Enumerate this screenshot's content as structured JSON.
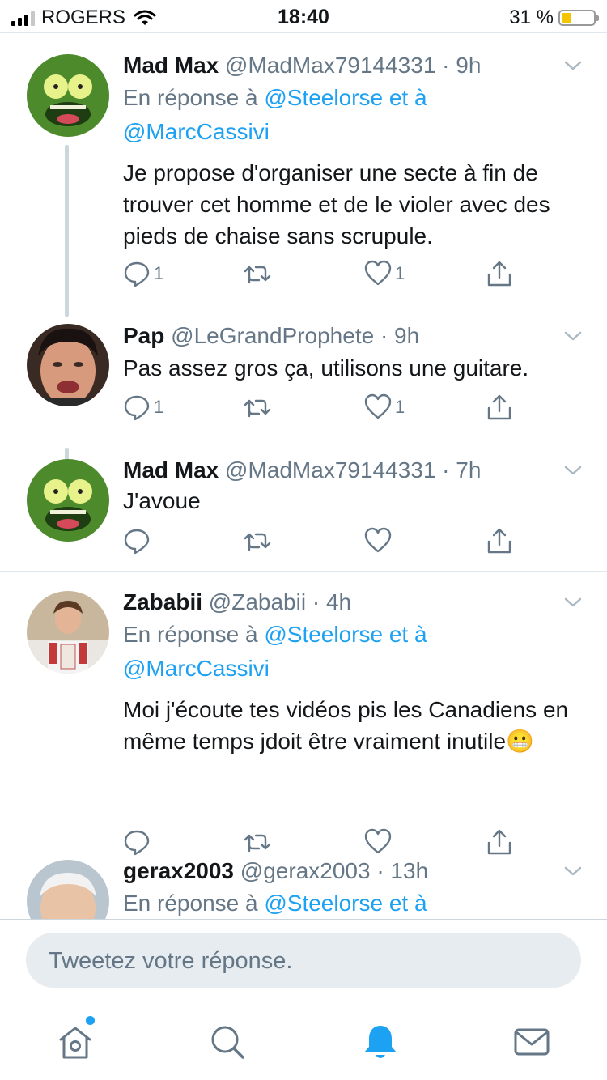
{
  "status": {
    "carrier": "ROGERS",
    "time": "18:40",
    "battery_pct": "31 %",
    "battery_level": 0.31
  },
  "tweets": [
    {
      "name": "Mad Max",
      "handle": "@MadMax79144331 · 9h",
      "reply_prefix": "En réponse à ",
      "reply_mention_1": "@Steelorse",
      "reply_mid": " et à",
      "reply_mention_2": "@MarcCassivi",
      "text": "Je propose d'organiser une secte à fin de trouver cet homme et de le violer avec des pieds de chaise sans scrupule.",
      "reply_count": "1",
      "like_count": "1"
    },
    {
      "name": "Pap",
      "handle": "@LeGrandProphete · 9h",
      "text": "Pas assez gros ça, utilisons une guitare.",
      "reply_count": "1",
      "like_count": "1"
    },
    {
      "name": "Mad Max",
      "handle": "@MadMax79144331 · 7h",
      "text": "J'avoue",
      "reply_count": "",
      "like_count": ""
    },
    {
      "name": "Zababii",
      "handle": "@Zababii · 4h",
      "reply_prefix": "En réponse à ",
      "reply_mention_1": "@Steelorse",
      "reply_mid": " et à",
      "reply_mention_2": "@MarcCassivi",
      "text": "Moi j'écoute tes vidéos pis les Canadiens en même temps jdoit être vraiment inutile",
      "emoji": "😬",
      "reply_count": "",
      "like_count": ""
    },
    {
      "name": "gerax2003",
      "handle": "@gerax2003 · 13h",
      "reply_prefix": "En réponse à ",
      "reply_mention_1": "@Steelorse",
      "reply_mid": " et à"
    }
  ],
  "composer": {
    "placeholder": "Tweetez votre réponse."
  },
  "tabs": [
    "home-icon",
    "search-icon",
    "notifications-icon",
    "messages-icon"
  ],
  "colors": {
    "accent": "#1da1f2",
    "secondary_text": "#657786",
    "primary_text": "#14171a"
  }
}
